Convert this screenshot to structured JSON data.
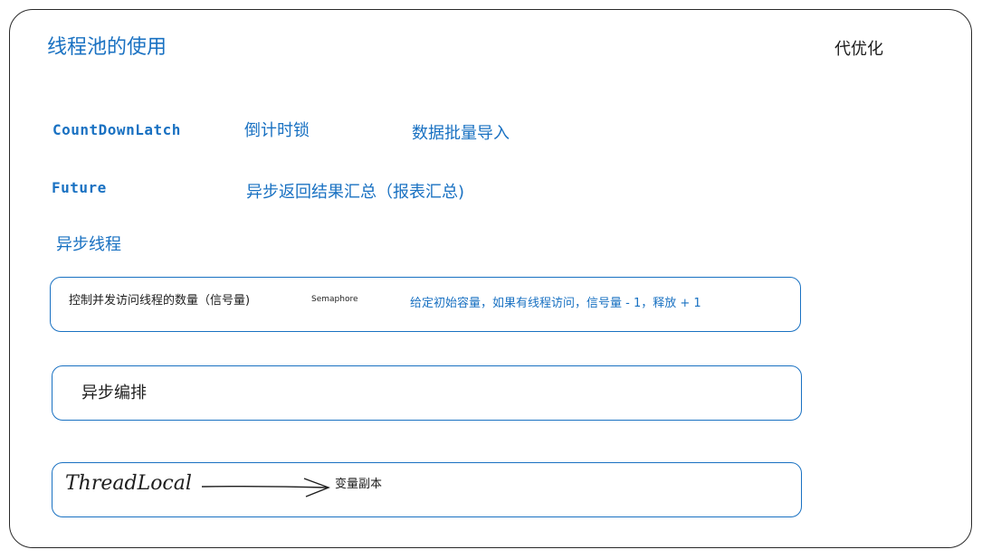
{
  "title": "线程池的使用",
  "note": "代优化",
  "items": [
    {
      "name": "CountDownLatch",
      "meaning": "倒计时锁",
      "use": "数据批量导入"
    },
    {
      "name": "Future",
      "meaning": "异步返回结果汇总（报表汇总)"
    },
    {
      "name": "异步线程"
    }
  ],
  "semaphore_box": {
    "label": "控制并发访问线程的数量（信号量)",
    "name": "Semaphore",
    "desc": "给定初始容量，如果有线程访问，信号量 - 1，释放 + 1"
  },
  "async_box": {
    "label": "异步编排"
  },
  "threadlocal_box": {
    "name": "ThreadLocal",
    "desc": "变量副本"
  }
}
